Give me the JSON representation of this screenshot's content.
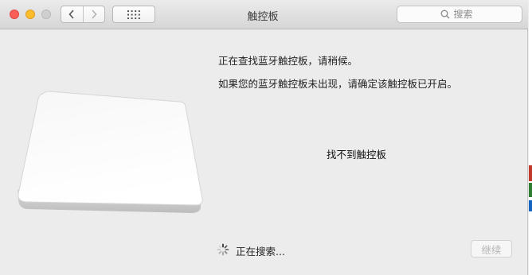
{
  "window": {
    "title": "触控板"
  },
  "toolbar": {
    "back_icon": "chevron-left-icon",
    "forward_icon": "chevron-right-icon",
    "grid_icon": "show-all-grid-icon"
  },
  "search": {
    "placeholder": "搜索",
    "icon": "search-icon"
  },
  "content": {
    "searching_heading": "正在查找蓝牙触控板，请稍候。",
    "instruction": "如果您的蓝牙触控板未出现，请确定该触控板已开启。",
    "status": "找不到触控板",
    "progress_label": "正在搜索...",
    "continue_label": "继续"
  },
  "colors": {
    "close": "#fc5f57",
    "minimize": "#fdbc2e",
    "zoom_disabled": "#cfcfcf",
    "disabled_text": "#b6b6b6"
  }
}
